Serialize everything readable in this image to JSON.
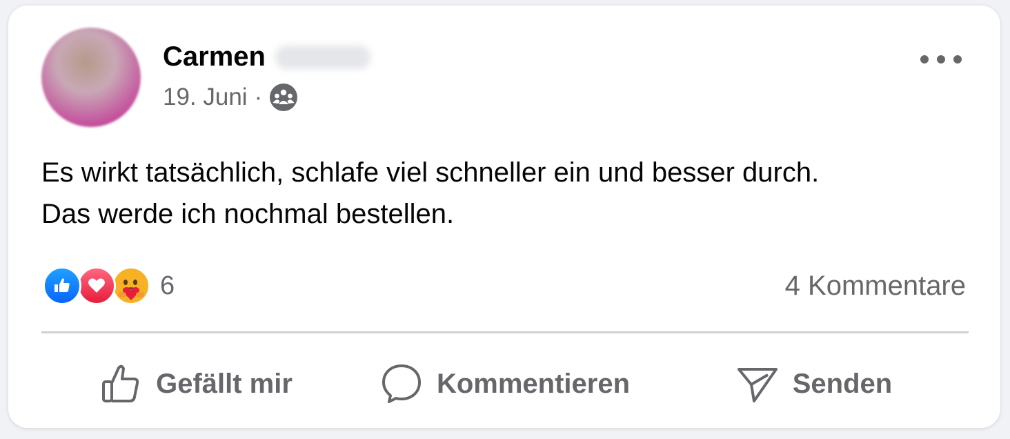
{
  "post": {
    "author_name": "Carmen",
    "date": "19. Juni",
    "separator": "·",
    "audience_icon": "friends-group-icon",
    "text_lines": [
      "Es wirkt tatsächlich, schlafe viel schneller ein und besser durch.",
      "Das werde ich nochmal bestellen."
    ]
  },
  "reactions": {
    "types": [
      "like",
      "love",
      "care"
    ],
    "count": "6"
  },
  "comments": {
    "label": "4 Kommentare"
  },
  "actions": {
    "like_label": "Gefällt mir",
    "comment_label": "Kommentieren",
    "send_label": "Senden"
  },
  "colors": {
    "like_blue": "#0866ff",
    "love_red": "#e61e3c",
    "care_yellow": "#f7b125",
    "secondary_text": "#65676b",
    "primary_text": "#050505"
  }
}
